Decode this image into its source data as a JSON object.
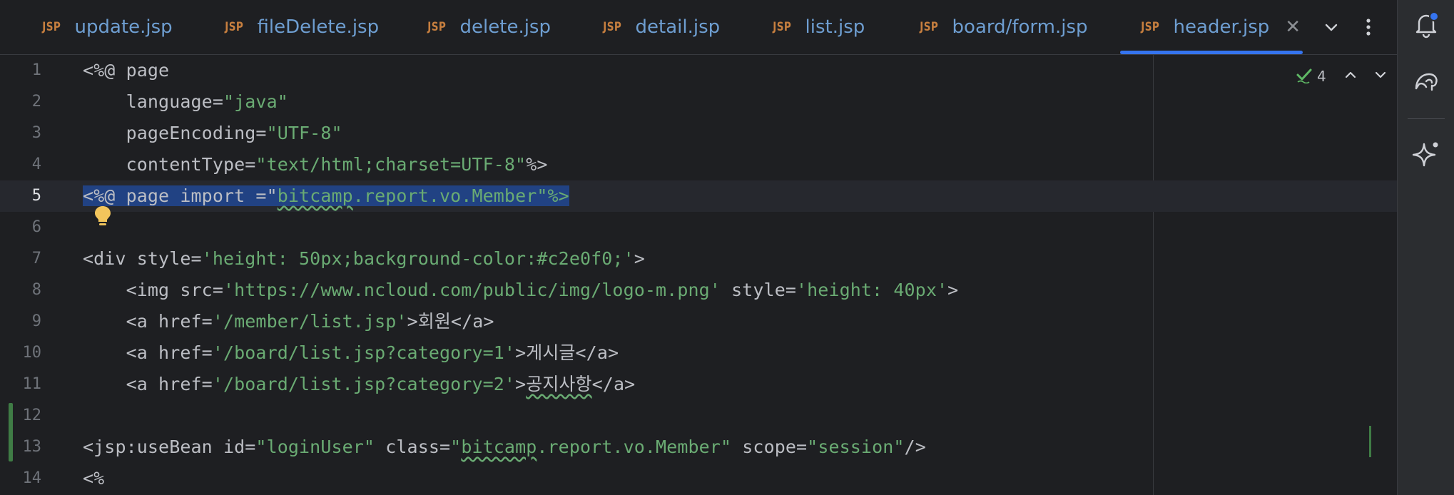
{
  "tabs": [
    {
      "type_label": "JSP",
      "name": "update.jsp"
    },
    {
      "type_label": "JSP",
      "name": "fileDelete.jsp"
    },
    {
      "type_label": "JSP",
      "name": "delete.jsp"
    },
    {
      "type_label": "JSP",
      "name": "detail.jsp"
    },
    {
      "type_label": "JSP",
      "name": "list.jsp"
    },
    {
      "type_label": "JSP",
      "name": "board/form.jsp"
    },
    {
      "type_label": "JSP",
      "name": "header.jsp",
      "active": true
    }
  ],
  "inspection": {
    "count": "4"
  },
  "line_numbers": [
    "1",
    "2",
    "3",
    "4",
    "5",
    "6",
    "7",
    "8",
    "9",
    "10",
    "11",
    "12",
    "13",
    "14"
  ],
  "code": {
    "l1": "<%@ page",
    "l2a": "    language=",
    "l2b": "\"java\"",
    "l3a": "    pageEncoding=",
    "l3b": "\"UTF-8\"",
    "l4a": "    contentType=",
    "l4b": "\"text/html;charset=UTF-8\"",
    "l4c": "%>",
    "l5a": "<%@ page import =\"",
    "l5b": "bitcamp",
    "l5c": ".report.vo.Member\"%>",
    "l7a": "<div style=",
    "l7b": "'height: 50px;background-color:#c2e0f0;'",
    "l7c": ">",
    "l8a": "    <img src=",
    "l8b": "'https://www.ncloud.com/public/img/logo-m.png'",
    "l8c": " style=",
    "l8d": "'height: 40px'",
    "l8e": ">",
    "l9a": "    <a href=",
    "l9b": "'/member/list.jsp'",
    "l9c": ">회원</a>",
    "l10a": "    <a href=",
    "l10b": "'/board/list.jsp?category=1'",
    "l10c": ">게시글</a>",
    "l11a": "    <a href=",
    "l11b": "'/board/list.jsp?category=2'",
    "l11c": ">",
    "l11d": "공지사항",
    "l11e": "</a>",
    "l13a": "<jsp:useBean id=",
    "l13b": "\"loginUser\"",
    "l13c": " class=",
    "l13d": "\"",
    "l13e": "bitcamp",
    "l13f": ".report.vo.Member\"",
    "l13g": " scope=",
    "l13h": "\"session\"",
    "l13i": "/>",
    "l14": "<%"
  },
  "colors": {
    "background": "#1e1f22",
    "string": "#6aab73",
    "selection": "#214283",
    "accent": "#3574f0",
    "jsp_label": "#c77f3f",
    "tab_text": "#6e9ed1"
  },
  "icons": {
    "tab_overflow": "chevron-down-icon",
    "tab_more": "more-vertical-icon",
    "notifications": "bell-icon",
    "database": "elephant-icon",
    "ai_assistant": "sparkle-icon",
    "intention": "lightbulb-icon",
    "inspection": "check-icon"
  }
}
